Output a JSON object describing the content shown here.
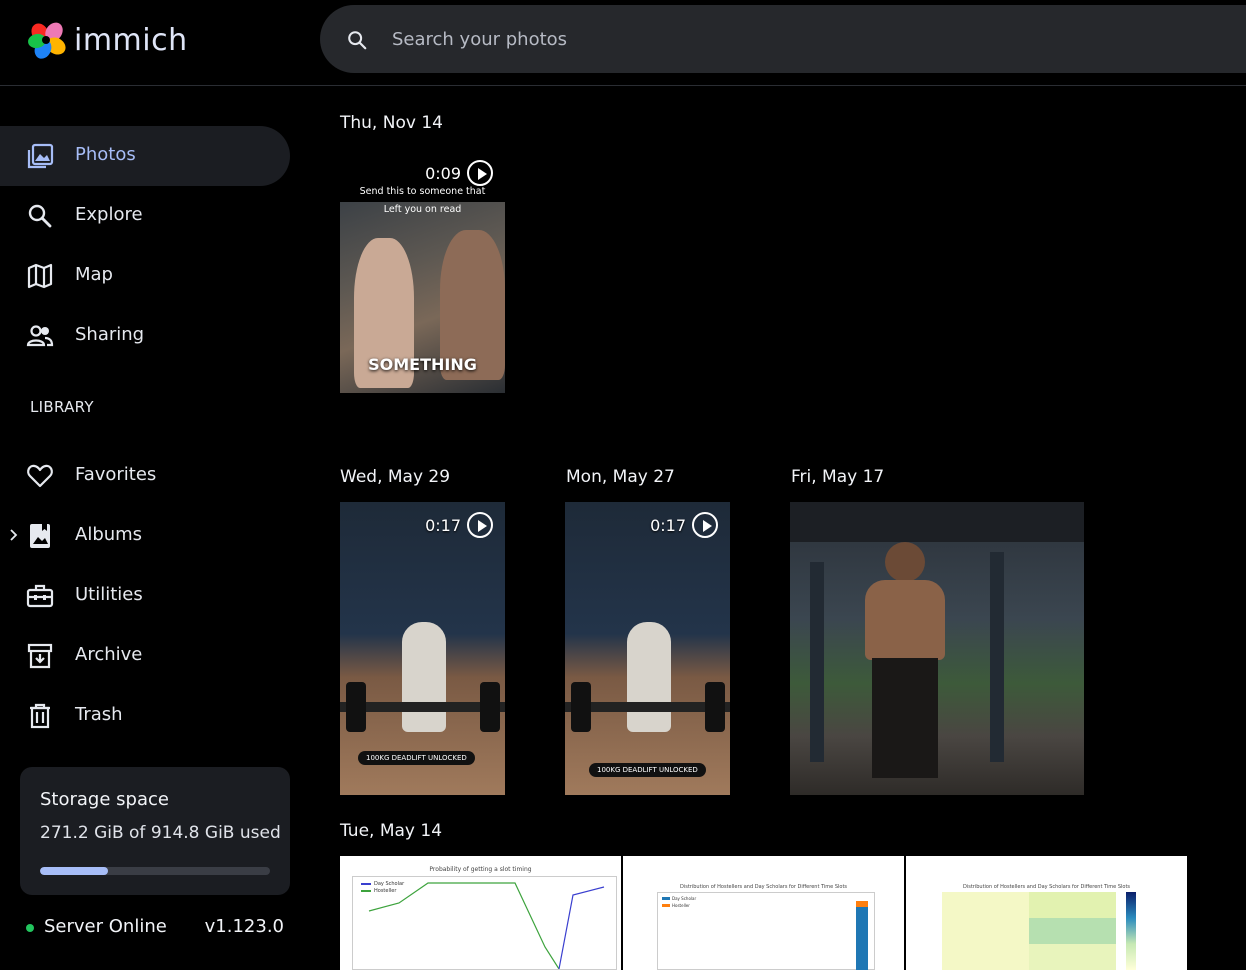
{
  "header": {
    "app_name": "immich",
    "search_placeholder": "Search your photos"
  },
  "sidebar": {
    "nav": [
      {
        "label": "Photos",
        "icon": "photos-icon"
      },
      {
        "label": "Explore",
        "icon": "search-icon"
      },
      {
        "label": "Map",
        "icon": "map-icon"
      },
      {
        "label": "Sharing",
        "icon": "people-icon"
      }
    ],
    "library_label": "LIBRARY",
    "library": [
      {
        "label": "Favorites",
        "icon": "heart-icon"
      },
      {
        "label": "Albums",
        "icon": "album-icon"
      },
      {
        "label": "Utilities",
        "icon": "toolbox-icon"
      },
      {
        "label": "Archive",
        "icon": "archive-icon"
      },
      {
        "label": "Trash",
        "icon": "trash-icon"
      }
    ],
    "storage": {
      "title": "Storage space",
      "used_text": "271.2 GiB of 914.8 GiB used",
      "used_fraction": 0.296
    },
    "server": {
      "status": "Server Online",
      "version": "v1.123.0"
    }
  },
  "timeline": {
    "groups": [
      {
        "date": "Thu, Nov 14",
        "items": [
          {
            "type": "video",
            "duration": "0:09",
            "caption_top": "Send this to someone that",
            "caption_mid": "Left you on read",
            "caption_bottom": "SOMETHING"
          }
        ]
      },
      {
        "date": "Wed, May 29",
        "items": [
          {
            "type": "video",
            "duration": "0:17",
            "badge": "100KG DEADLIFT UNLOCKED"
          }
        ]
      },
      {
        "date": "Mon, May 27",
        "items": [
          {
            "type": "video",
            "duration": "0:17",
            "badge": "100KG DEADLIFT UNLOCKED"
          }
        ]
      },
      {
        "date": "Fri, May 17",
        "items": [
          {
            "type": "photo"
          }
        ]
      },
      {
        "date": "Tue, May 14",
        "items": [
          {
            "type": "photo",
            "title": "Probability of getting a slot timing",
            "legend": [
              "Day Scholar",
              "Hosteller"
            ]
          },
          {
            "type": "photo",
            "title": "Distribution of Hostellers and Day Scholars for Different Time Slots",
            "legend": [
              "Day Scholar",
              "Hosteller"
            ]
          },
          {
            "type": "photo",
            "title": "Distribution of Hostellers and Day Scholars for Different Time Slots"
          }
        ]
      }
    ]
  },
  "colors": {
    "accent": "#a7bdf7",
    "online": "#22c55e",
    "sidebar_active": "#1b1d22"
  }
}
